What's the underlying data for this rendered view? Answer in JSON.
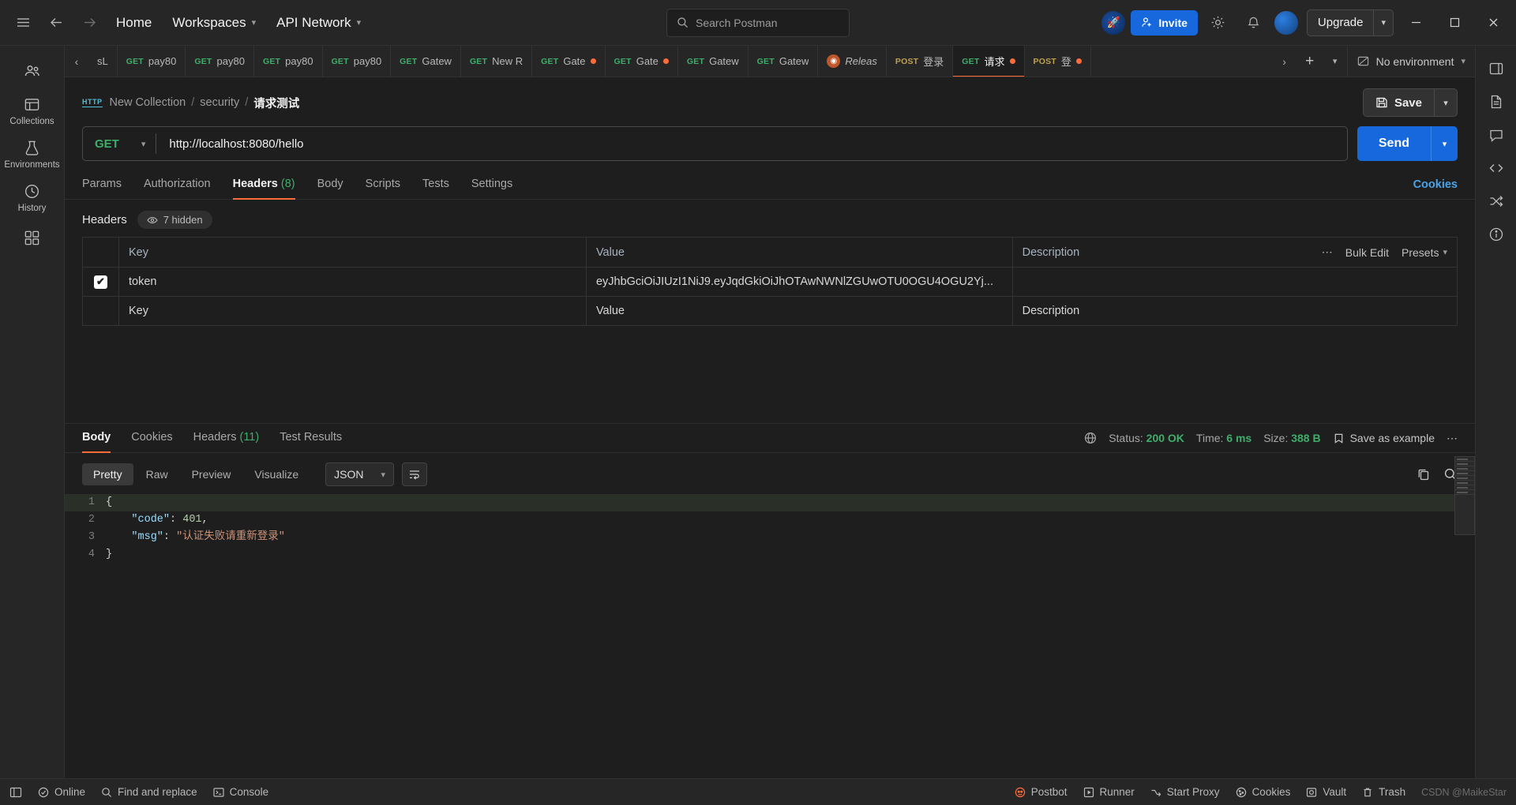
{
  "topbar": {
    "hamburger_icon": "hamburger-icon",
    "back_icon": "back-arrow-icon",
    "forward_icon": "forward-arrow-icon",
    "home": "Home",
    "workspaces": "Workspaces",
    "api_network": "API Network",
    "search_placeholder": "Search Postman",
    "invite": "Invite",
    "upgrade": "Upgrade",
    "settings_icon": "gear-icon",
    "notifications_icon": "bell-icon",
    "minimize": "─",
    "maximize": "☐",
    "close": "✕"
  },
  "rail": {
    "items": [
      {
        "label": "",
        "icon": "people-icon"
      },
      {
        "label": "Collections",
        "icon": "collections-icon"
      },
      {
        "label": "Environments",
        "icon": "environments-icon"
      },
      {
        "label": "History",
        "icon": "history-icon"
      },
      {
        "label": "",
        "icon": "apps-grid-icon"
      }
    ]
  },
  "tabstrip": {
    "prev_icon": "chevron-left-icon",
    "next_icon": "chevron-right-icon",
    "add_icon": "plus-icon",
    "caret_icon": "chevron-down-icon",
    "environment": "No environment",
    "tabs": [
      {
        "method": "",
        "title": "sL",
        "dirty": false,
        "active": false,
        "kind": "plain"
      },
      {
        "method": "GET",
        "title": "pay80",
        "dirty": false,
        "active": false,
        "kind": "req"
      },
      {
        "method": "GET",
        "title": "pay80",
        "dirty": false,
        "active": false,
        "kind": "req"
      },
      {
        "method": "GET",
        "title": "pay80",
        "dirty": false,
        "active": false,
        "kind": "req"
      },
      {
        "method": "GET",
        "title": "pay80",
        "dirty": false,
        "active": false,
        "kind": "req"
      },
      {
        "method": "GET",
        "title": "Gatew",
        "dirty": false,
        "active": false,
        "kind": "req"
      },
      {
        "method": "GET",
        "title": "New R",
        "dirty": false,
        "active": false,
        "kind": "req"
      },
      {
        "method": "GET",
        "title": "Gate",
        "dirty": true,
        "active": false,
        "kind": "req"
      },
      {
        "method": "GET",
        "title": "Gate",
        "dirty": true,
        "active": false,
        "kind": "req"
      },
      {
        "method": "GET",
        "title": "Gatew",
        "dirty": false,
        "active": false,
        "kind": "req"
      },
      {
        "method": "GET",
        "title": "Gatew",
        "dirty": false,
        "active": false,
        "kind": "req"
      },
      {
        "method": "",
        "title": "Releas",
        "dirty": false,
        "active": false,
        "kind": "release"
      },
      {
        "method": "POST",
        "title": "登录",
        "dirty": false,
        "active": false,
        "kind": "req"
      },
      {
        "method": "GET",
        "title": "请求",
        "dirty": true,
        "active": true,
        "kind": "req"
      },
      {
        "method": "POST",
        "title": "登",
        "dirty": true,
        "active": false,
        "kind": "req"
      }
    ]
  },
  "breadcrumb": {
    "protocol_badge": "HTTP",
    "items": [
      "New Collection",
      "security"
    ],
    "current": "请求测试",
    "save_label": "Save",
    "save_icon": "floppy-disk-icon",
    "save_caret": "chevron-down-icon"
  },
  "request": {
    "method": "GET",
    "url": "http://localhost:8080/hello",
    "send_label": "Send",
    "send_caret": "chevron-down-icon"
  },
  "request_tabs": {
    "items": [
      {
        "label": "Params",
        "count": "",
        "active": false
      },
      {
        "label": "Authorization",
        "count": "",
        "active": false
      },
      {
        "label": "Headers",
        "count": "(8)",
        "active": true
      },
      {
        "label": "Body",
        "count": "",
        "active": false
      },
      {
        "label": "Scripts",
        "count": "",
        "active": false
      },
      {
        "label": "Tests",
        "count": "",
        "active": false
      },
      {
        "label": "Settings",
        "count": "",
        "active": false
      }
    ],
    "cookies_link": "Cookies"
  },
  "headers_section": {
    "title": "Headers",
    "hidden_pill": "7 hidden",
    "eye_icon": "eye-icon",
    "columns": {
      "key": "Key",
      "value": "Value",
      "description": "Description"
    },
    "more_icon": "ellipsis-icon",
    "bulk_edit": "Bulk Edit",
    "presets": "Presets",
    "presets_caret": "chevron-down-icon",
    "rows": [
      {
        "checked": true,
        "key": "token",
        "value": "eyJhbGciOiJIUzI1NiJ9.eyJqdGkiOiJhOTAwNWNlZGUwOTU0OGU4OGU2Yj...",
        "description": ""
      }
    ],
    "empty_row": {
      "key": "Key",
      "value": "Value",
      "description": "Description"
    }
  },
  "response": {
    "tabs": [
      {
        "label": "Body",
        "count": "",
        "active": true
      },
      {
        "label": "Cookies",
        "count": "",
        "active": false
      },
      {
        "label": "Headers",
        "count": "(11)",
        "active": false
      },
      {
        "label": "Test Results",
        "count": "",
        "active": false
      }
    ],
    "globe_icon": "globe-icon",
    "status_label": "Status:",
    "status_value": "200 OK",
    "time_label": "Time:",
    "time_value": "6 ms",
    "size_label": "Size:",
    "size_value": "388 B",
    "save_example": "Save as example",
    "save_example_icon": "bookmark-icon",
    "more_icon": "ellipsis-icon",
    "view_modes": [
      {
        "label": "Pretty",
        "active": true
      },
      {
        "label": "Raw",
        "active": false
      },
      {
        "label": "Preview",
        "active": false
      },
      {
        "label": "Visualize",
        "active": false
      }
    ],
    "format": "JSON",
    "format_caret": "chevron-down-icon",
    "wrap_icon": "word-wrap-icon",
    "copy_icon": "copy-icon",
    "search_icon": "search-icon",
    "body_lines": [
      {
        "n": "1",
        "highlight": true,
        "tokens": [
          {
            "t": "{",
            "c": "punc"
          }
        ]
      },
      {
        "n": "2",
        "highlight": false,
        "tokens": [
          {
            "t": "    ",
            "c": "punc"
          },
          {
            "t": "\"code\"",
            "c": "key"
          },
          {
            "t": ": ",
            "c": "punc"
          },
          {
            "t": "401",
            "c": "num"
          },
          {
            "t": ",",
            "c": "punc"
          }
        ]
      },
      {
        "n": "3",
        "highlight": false,
        "tokens": [
          {
            "t": "    ",
            "c": "punc"
          },
          {
            "t": "\"msg\"",
            "c": "key"
          },
          {
            "t": ": ",
            "c": "punc"
          },
          {
            "t": "\"认证失败请重新登录\"",
            "c": "str"
          }
        ]
      },
      {
        "n": "4",
        "highlight": false,
        "tokens": [
          {
            "t": "}",
            "c": "punc"
          }
        ]
      }
    ]
  },
  "right_rail": {
    "items": [
      {
        "icon": "sidebar-panel-icon"
      },
      {
        "icon": "document-icon"
      },
      {
        "icon": "comment-icon"
      },
      {
        "icon": "code-icon"
      },
      {
        "icon": "shuffle-icon"
      },
      {
        "icon": "info-icon"
      }
    ]
  },
  "statusbar": {
    "panel_icon": "panel-toggle-icon",
    "online": "Online",
    "find_replace": "Find and replace",
    "console": "Console",
    "postbot": "Postbot",
    "runner": "Runner",
    "start_proxy": "Start Proxy",
    "cookies": "Cookies",
    "vault": "Vault",
    "trash": "Trash",
    "watermark": "CSDN @MaikeStar"
  },
  "colors": {
    "accent": "#ff6c37",
    "primary": "#1668dc",
    "success": "#3fae6a",
    "bg": "#1e1e1e",
    "panel": "#262626"
  }
}
